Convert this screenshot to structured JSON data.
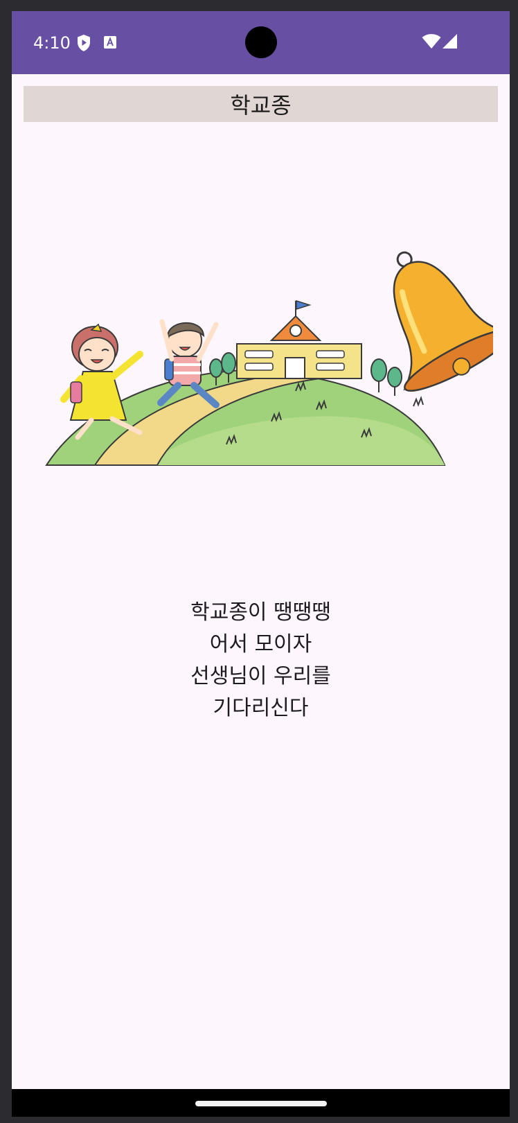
{
  "status_bar": {
    "time": "4:10",
    "icons": [
      "shield-play-icon",
      "text-a-icon",
      "wifi-icon",
      "cell-signal-icon"
    ],
    "background": "#6750a4"
  },
  "app": {
    "title": "학교종",
    "title_background": "#e0d6d3",
    "screen_background": "#fdf6fc"
  },
  "illustration": {
    "icons": [
      "girl-icon",
      "boy-icon",
      "school-building-icon",
      "bell-icon",
      "hill-icon",
      "path-icon",
      "tree-icon"
    ]
  },
  "lyrics": [
    "학교종이 땡땡땡",
    "어서 모이자",
    "선생님이 우리를",
    "기다리신다"
  ]
}
